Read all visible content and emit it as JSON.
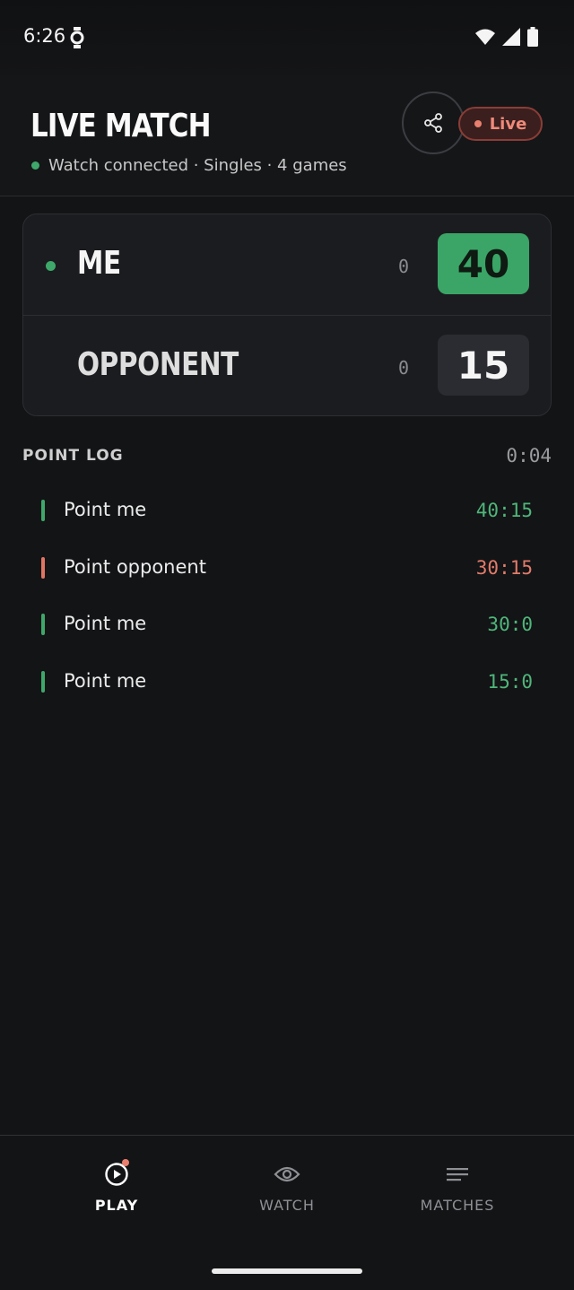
{
  "status_bar": {
    "time": "6:26"
  },
  "header": {
    "title": "LIVE MATCH",
    "subtitle": "Watch connected · Singles · 4 games",
    "live_label": "Live"
  },
  "score": {
    "me": {
      "name": "ME",
      "games": "0",
      "points": "40"
    },
    "opponent": {
      "name": "OPPONENT",
      "games": "0",
      "points": "15"
    }
  },
  "point_log": {
    "title": "POINT LOG",
    "elapsed": "0:04",
    "entries": [
      {
        "label": "Point me",
        "score": "40:15",
        "side": "me"
      },
      {
        "label": "Point opponent",
        "score": "30:15",
        "side": "opponent"
      },
      {
        "label": "Point me",
        "score": "30:0",
        "side": "me"
      },
      {
        "label": "Point me",
        "score": "15:0",
        "side": "me"
      }
    ]
  },
  "nav": {
    "items": [
      {
        "label": "PLAY",
        "icon": "play-circle-icon",
        "active": true
      },
      {
        "label": "WATCH",
        "icon": "eye-icon",
        "active": false
      },
      {
        "label": "MATCHES",
        "icon": "list-icon",
        "active": false
      }
    ]
  },
  "colors": {
    "accent_green": "#3aa566",
    "live_red": "#e9806f",
    "background": "#131416"
  }
}
